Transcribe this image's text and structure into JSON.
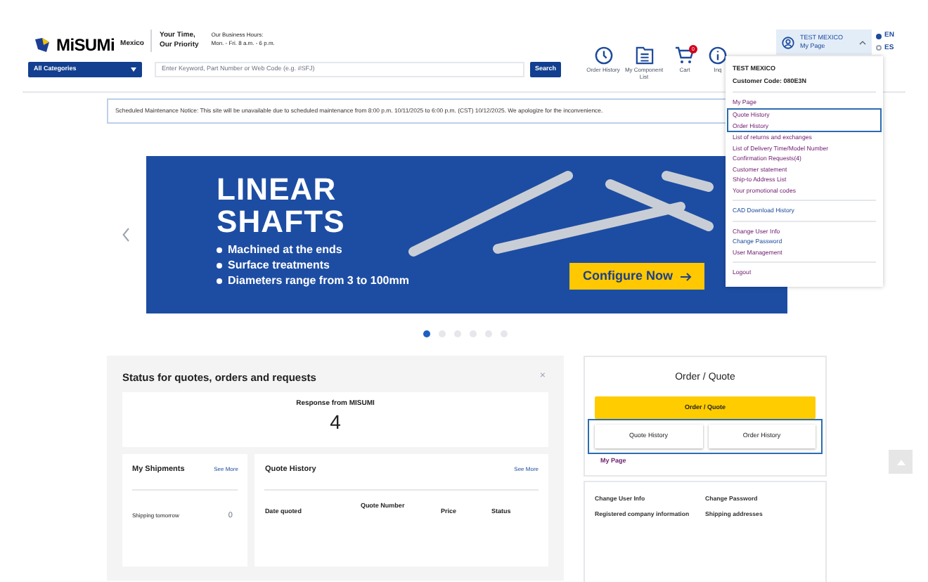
{
  "header": {
    "brand": "MiSUMi",
    "region": "Mexico",
    "tagline": [
      "Your Time,",
      "Our Priority"
    ],
    "hours": [
      "Our Business Hours:",
      "Mon. - Fri. 8 a.m. - 6 p.m."
    ]
  },
  "search": {
    "category": "All Categories",
    "placeholder": "Enter Keyword, Part Number or Web Code (e.g. #SFJ)",
    "button": "Search"
  },
  "nav_icons": [
    {
      "kind": "clock",
      "label": "Order History"
    },
    {
      "kind": "list",
      "label": "My Component List"
    },
    {
      "kind": "cart",
      "label": "Cart",
      "badge": "0"
    },
    {
      "kind": "info",
      "label": "Inq"
    }
  ],
  "account": {
    "name": "TEST MEXICO",
    "link": "My Page",
    "expanded": true
  },
  "languages": [
    {
      "label": "EN",
      "selected": true
    },
    {
      "label": "ES",
      "selected": false
    }
  ],
  "notice": "Scheduled Maintenance Notice: This site will be unavailable due to scheduled maintenance from 8:00 p.m. 10/11/2025 to 6:00 p.m. (CST) 10/12/2025. We apologize for the inconvenience.",
  "banner": {
    "title": [
      "LINEAR",
      "SHAFTS"
    ],
    "bullets": [
      "Machined at the ends",
      "Surface treatments",
      "Diameters range from 3 to 100mm"
    ],
    "button": "Configure Now"
  },
  "carousel": [
    {
      "selected": true
    },
    {
      "selected": false
    },
    {
      "selected": false
    },
    {
      "selected": false
    },
    {
      "selected": false
    },
    {
      "selected": false
    }
  ],
  "dropdown": {
    "name": "TEST MEXICO",
    "code": "Customer Code: 080E3N",
    "sections": [
      {
        "divider": true,
        "highlighted": false,
        "items": [
          {
            "label": "My Page",
            "visited": true
          }
        ]
      },
      {
        "divider": false,
        "highlighted": true,
        "items": [
          {
            "label": "Quote History",
            "visited": true
          },
          {
            "label": "Order History",
            "visited": true
          }
        ]
      },
      {
        "divider": false,
        "highlighted": false,
        "items": [
          {
            "label": "List of returns and exchanges",
            "visited": true
          },
          {
            "label": "List of Delivery Time/Model Number",
            "visited": true
          },
          {
            "label": "Confirmation Requests(4)",
            "visited": true
          },
          {
            "label": "Customer statement",
            "visited": true
          },
          {
            "label": "Ship-to Address List",
            "visited": true
          },
          {
            "label": "Your promotional codes",
            "visited": true
          }
        ]
      },
      {
        "divider": true,
        "highlighted": false,
        "items": [
          {
            "label": "CAD Download History",
            "visited": false
          }
        ]
      },
      {
        "divider": true,
        "highlighted": false,
        "items": [
          {
            "label": "Change User Info",
            "visited": true
          },
          {
            "label": "Change Password",
            "visited": false
          },
          {
            "label": "User Management",
            "visited": true
          }
        ]
      },
      {
        "divider": true,
        "highlighted": false,
        "items": [
          {
            "label": "Logout",
            "visited": true
          }
        ]
      }
    ]
  },
  "status_panel": {
    "title": "Status for quotes, orders and requests",
    "close": "×",
    "response": {
      "label": "Response from MISUMI",
      "count": "4"
    },
    "shipments": {
      "title": "My Shipments",
      "link": "See More",
      "rows": [
        {
          "label": "Shipping tomorrow",
          "count": "0"
        }
      ]
    },
    "quotes": {
      "title": "Quote History",
      "link": "See More",
      "columns": [
        "Date quoted",
        "Quote Number",
        "Price",
        "Status"
      ]
    }
  },
  "order_card": {
    "title": "Order / Quote",
    "primary": "Order / Quote",
    "buttons": [
      "Quote History",
      "Order History"
    ],
    "highlighted": true,
    "link": "My Page"
  },
  "links_card": {
    "links": [
      "Change User Info",
      "Change Password",
      "Registered company information",
      "Shipping addresses"
    ]
  }
}
